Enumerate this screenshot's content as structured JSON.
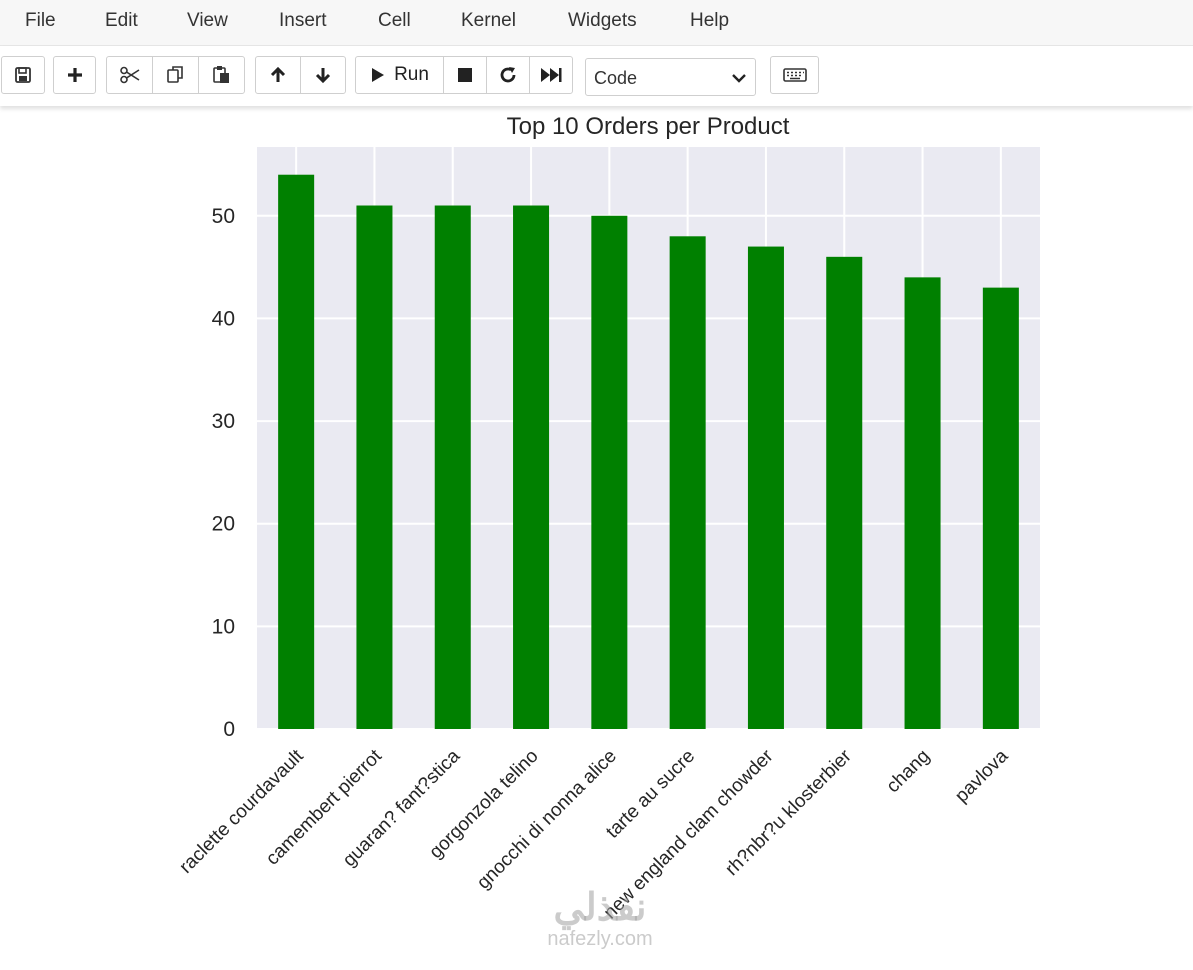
{
  "menubar": {
    "items": [
      "File",
      "Edit",
      "View",
      "Insert",
      "Cell",
      "Kernel",
      "Widgets",
      "Help"
    ]
  },
  "toolbar": {
    "save_icon": "floppy-disk-icon",
    "insert_cell_icon": "plus-icon",
    "cut_icon": "scissors-icon",
    "copy_icon": "copy-icon",
    "paste_icon": "paste-icon",
    "move_up_icon": "arrow-up-icon",
    "move_down_icon": "arrow-down-icon",
    "run_label": "Run",
    "interrupt_icon": "stop-icon",
    "restart_icon": "restart-icon",
    "run_all_icon": "fast-forward-icon",
    "cell_type": "Code",
    "keyboard_icon": "keyboard-icon"
  },
  "chart_data": {
    "type": "bar",
    "title": "Top 10 Orders per Product",
    "categories": [
      "raclette courdavault",
      "camembert pierrot",
      "guaran? fant?stica",
      "gorgonzola telino",
      "gnocchi di nonna alice",
      "tarte au sucre",
      "new england clam chowder",
      "rh?nbr?u klosterbier",
      "chang",
      "pavlova"
    ],
    "values": [
      54,
      51,
      51,
      51,
      50,
      48,
      47,
      46,
      44,
      43
    ],
    "yticks": [
      0,
      10,
      20,
      30,
      40,
      50
    ],
    "ylim": [
      0,
      56.7
    ],
    "xlabel": "",
    "ylabel": "",
    "grid": true,
    "bar_color": "#008000",
    "plot_background": "#eaeaf2",
    "grid_color": "#ffffff"
  },
  "watermark": {
    "arabic": "نفذلي",
    "latin": "nafezly.com"
  }
}
